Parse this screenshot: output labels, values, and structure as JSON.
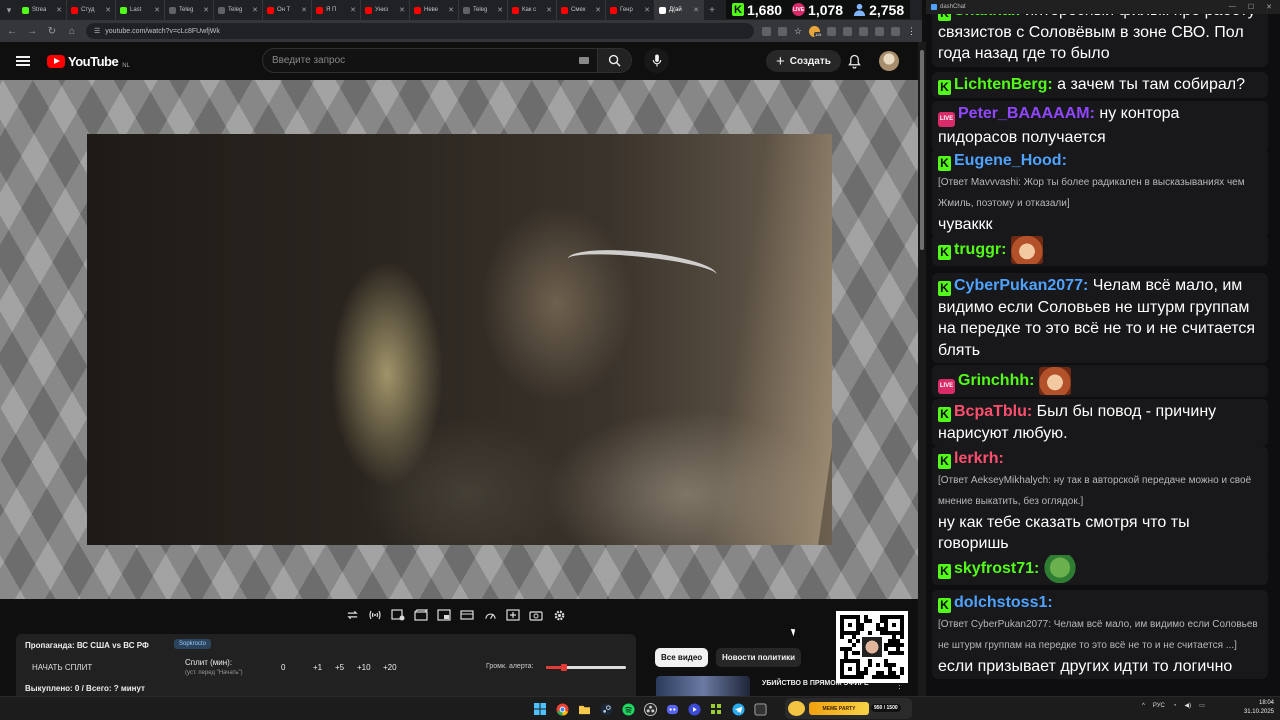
{
  "browser": {
    "tabs": [
      {
        "label": "Strea",
        "color": "#53fc18",
        "active": false
      },
      {
        "label": "Студ",
        "color": "#ff0000",
        "active": false
      },
      {
        "label": "Last",
        "color": "#53fc18",
        "active": false
      },
      {
        "label": "Teleg",
        "color": "#5f6368",
        "active": false
      },
      {
        "label": "Teleg",
        "color": "#5f6368",
        "active": false
      },
      {
        "label": "Он Т",
        "color": "#ff0000",
        "active": false
      },
      {
        "label": "Я П",
        "color": "#ff0000",
        "active": false
      },
      {
        "label": "Униз",
        "color": "#ff0000",
        "active": false
      },
      {
        "label": "Неве",
        "color": "#ff0000",
        "active": false
      },
      {
        "label": "Teleg",
        "color": "#5f6368",
        "active": false
      },
      {
        "label": "Как с",
        "color": "#ff0000",
        "active": false
      },
      {
        "label": "Смех",
        "color": "#ff0000",
        "active": false
      },
      {
        "label": "Генр",
        "color": "#ff0000",
        "active": false
      },
      {
        "label": "Д(ай",
        "color": "#ffffff",
        "active": true
      }
    ],
    "url": "youtube.com/watch?v=cLc8FUwfjWk",
    "extension_badge": "115"
  },
  "stats": {
    "kick_viewers": "1,680",
    "live_viewers": "1,078",
    "total_viewers": "2,758",
    "kick_color": "#53fc18",
    "live_color": "#d92b6a"
  },
  "youtube": {
    "logo_text": "YouTube",
    "region": "NL",
    "search_placeholder": "Введите запрос",
    "create_label": "Создать"
  },
  "split_panel": {
    "title": "Пропаганда: ВС США vs ВС РФ",
    "link_label": "Sopkrocto",
    "start_label": "НАЧАТЬ СПЛИТ",
    "split_label": "Сплит (мин):",
    "split_hint": "(уст. перед \"Начать\")",
    "split_value": "0",
    "add_buttons": [
      "+1",
      "+5",
      "+10",
      "+20"
    ],
    "volume_label": "Громк. алерта:",
    "volume_fraction": 0.22,
    "status": "Выкуплено: 0 / Всего: ? минут"
  },
  "chips": {
    "all_videos": "Все видео",
    "politics": "Новости политики"
  },
  "recommendation": {
    "title": "УБИЙСТВО В ПРЯМОМ ЭФИРЕ"
  },
  "chat": {
    "window_title": "dashChat",
    "messages": [
      {
        "platform": "kick",
        "user": "Shakhai",
        "color": "#53fc18",
        "text": "интересный фильм про работу связистов с Соловёвым в зоне СВО. Пол года назад где то было"
      },
      {
        "platform": "kick",
        "user": "LichtenBerg",
        "color": "#53fc18",
        "text": "а зачем ты там собирал?"
      },
      {
        "platform": "live",
        "user": "Peter_BAAAAAM",
        "color": "#9146ff",
        "text": "ну контора пидорасов получается"
      },
      {
        "platform": "kick",
        "user": "Eugene_Hood",
        "color": "#4fa3ff",
        "reply": "[Ответ Mavvvashi: Жор ты более радикален в высказываниях чем Жмиль, поэтому и отказали]",
        "text": "чуваккк"
      },
      {
        "platform": "kick",
        "user": "truggr",
        "color": "#53fc18",
        "text": "",
        "emote": "laugh"
      },
      {
        "platform": "kick",
        "user": "CyberPukan2077",
        "color": "#4fa3ff",
        "text": "Челам всё мало, им видимо если Соловьев не штурм группам на передке то это всё не то и не считается блять"
      },
      {
        "platform": "live",
        "user": "Grinchhh",
        "color": "#53fc18",
        "text": "",
        "emote": "laugh"
      },
      {
        "platform": "kick",
        "user": "BcpaTblu",
        "color": "#ff4f6e",
        "text": "Был бы повод - причину нарисуют любую."
      },
      {
        "platform": "kick",
        "user": "lerkrh",
        "color": "#ff4f6e",
        "reply": "[Ответ AekseyMikhalych: ну так в авторской передаче можно и своё мнение выкатить, без оглядок.]",
        "text": "ну как тебе сказать смотря что ты говоришь"
      },
      {
        "platform": "kick",
        "user": "skyfrost71",
        "color": "#53fc18",
        "text": "",
        "emote": "pepe"
      },
      {
        "platform": "kick",
        "user": "dolchstoss1",
        "color": "#4fa3ff",
        "reply": "[Ответ CyberPukan2077: Челам всё мало, им видимо если Соловьев не штурм группам на передке то это всё не то и не считается ...]",
        "text": "если призывает других идти то логично"
      }
    ]
  },
  "taskbar": {
    "meme_label": "MEME PARTY",
    "meme_score": "950 / 1500",
    "lang": "РУС",
    "time": "18:04",
    "date": "31.10.2025"
  }
}
